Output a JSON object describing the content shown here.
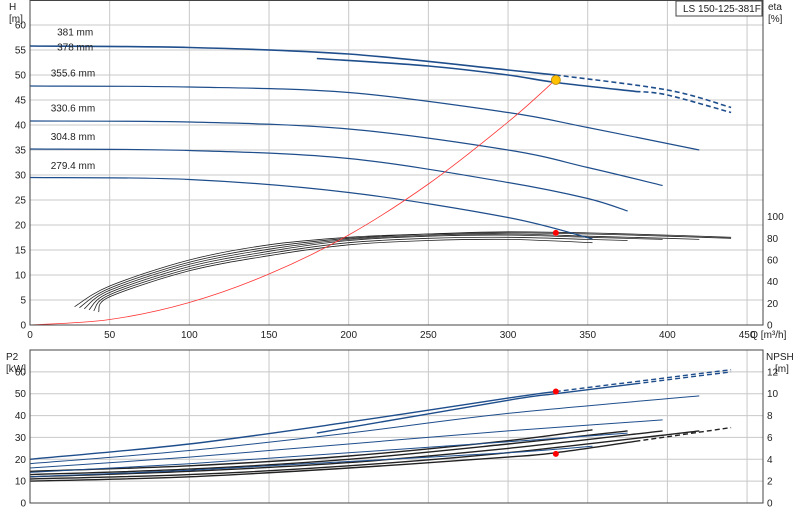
{
  "chart_data": [
    {
      "type": "line",
      "title": "LS 150-125-381F",
      "ylabel_left": "H",
      "ylabel_left_unit": "[m]",
      "ylabel_right": "eta",
      "ylabel_right_unit": "[%]",
      "xlabel": "Q [m³/h]",
      "x_ticks": [
        "0",
        "50",
        "100",
        "150",
        "200",
        "250",
        "300",
        "350",
        "400",
        "450"
      ],
      "xlim": [
        0,
        460
      ],
      "y_ticks": [
        "0",
        "5",
        "10",
        "15",
        "20",
        "25",
        "30",
        "35",
        "40",
        "45",
        "50",
        "55",
        "60"
      ],
      "ylim": [
        0,
        65
      ],
      "y_right_ticks": [
        "0",
        "20",
        "40",
        "60",
        "80",
        "100"
      ],
      "y_right_lim": [
        0,
        300
      ],
      "grid": true,
      "head_series": [
        {
          "name": "381 mm",
          "x": [
            0,
            100,
            200,
            300,
            330,
            400,
            440
          ],
          "y": [
            55.8,
            55.5,
            54.2,
            51.0,
            50.0,
            47.0,
            43.5
          ],
          "dash_from": 330
        },
        {
          "name": "378 mm",
          "x": [
            180,
            250,
            300,
            330,
            400,
            440
          ],
          "y": [
            53.3,
            51.8,
            50.0,
            48.5,
            46.0,
            42.5
          ],
          "dash_from": 380
        },
        {
          "name": "355.6 mm",
          "x": [
            0,
            100,
            200,
            300,
            350,
            420
          ],
          "y": [
            47.8,
            47.6,
            46.5,
            42.5,
            39.5,
            35.0
          ]
        },
        {
          "name": "330.6 mm",
          "x": [
            0,
            100,
            200,
            300,
            350,
            397
          ],
          "y": [
            40.8,
            40.6,
            39.2,
            35.0,
            31.5,
            27.9
          ]
        },
        {
          "name": "304.8 mm",
          "x": [
            0,
            100,
            200,
            300,
            350,
            375
          ],
          "y": [
            35.2,
            34.9,
            33.3,
            28.5,
            25.3,
            22.8
          ]
        },
        {
          "name": "279.4 mm",
          "x": [
            0,
            100,
            200,
            300,
            353
          ],
          "y": [
            29.5,
            29.1,
            26.5,
            21.5,
            17.2
          ]
        }
      ],
      "efficiency_series": [
        {
          "x": [
            28,
            50,
            100,
            150,
            200,
            250,
            300,
            350,
            400,
            440
          ],
          "y": [
            17,
            36,
            60,
            74,
            81,
            84,
            85,
            84,
            82,
            80
          ]
        },
        {
          "x": [
            31,
            50,
            100,
            150,
            200,
            250,
            300,
            350,
            400,
            440
          ],
          "y": [
            16,
            34,
            58,
            72,
            80,
            84,
            86,
            85,
            83,
            81
          ]
        },
        {
          "x": [
            34,
            50,
            100,
            150,
            200,
            250,
            300,
            350,
            400,
            420
          ],
          "y": [
            15,
            32,
            56,
            70,
            79,
            83,
            84,
            82,
            80,
            79
          ]
        },
        {
          "x": [
            37,
            50,
            100,
            150,
            200,
            250,
            300,
            350,
            397
          ],
          "y": [
            14,
            30,
            54,
            68,
            78,
            82,
            83,
            81,
            79
          ]
        },
        {
          "x": [
            40,
            50,
            100,
            150,
            200,
            250,
            300,
            350,
            375
          ],
          "y": [
            13,
            28,
            52,
            66,
            76,
            80,
            81,
            79,
            78
          ]
        },
        {
          "x": [
            43,
            50,
            100,
            150,
            200,
            250,
            300,
            353
          ],
          "y": [
            12,
            26,
            50,
            64,
            74,
            78,
            79,
            76
          ]
        }
      ],
      "system_curve": {
        "x": [
          0,
          50,
          100,
          150,
          200,
          250,
          300,
          330
        ],
        "y": [
          0,
          1.1,
          4.5,
          10.2,
          18.0,
          28.2,
          40.6,
          49.1
        ]
      },
      "duty_point": {
        "x": 330,
        "y": 49
      },
      "eta_point": {
        "x": 330,
        "y": 85
      }
    },
    {
      "type": "line",
      "ylabel_left": "P2",
      "ylabel_left_unit": "[kW]",
      "ylabel_right": "NPSH",
      "ylabel_right_unit": "[m]",
      "xlim": [
        0,
        460
      ],
      "y_ticks": [
        "0",
        "10",
        "20",
        "30",
        "40",
        "50",
        "60"
      ],
      "ylim": [
        0,
        70
      ],
      "y_right_ticks": [
        "0",
        "2",
        "4",
        "6",
        "8",
        "10",
        "12"
      ],
      "y_right_lim": [
        0,
        14
      ],
      "grid": true,
      "power_series": [
        {
          "x": [
            0,
            100,
            200,
            300,
            330,
            440
          ],
          "y": [
            20,
            27,
            37,
            48,
            51,
            61
          ],
          "dash_from": 330
        },
        {
          "x": [
            180,
            300,
            330,
            440
          ],
          "y": [
            32,
            47,
            50,
            60
          ],
          "dash_from": 380
        },
        {
          "x": [
            0,
            100,
            200,
            300,
            420
          ],
          "y": [
            18,
            24,
            32,
            41,
            49
          ]
        },
        {
          "x": [
            0,
            100,
            200,
            300,
            397
          ],
          "y": [
            16,
            21,
            27,
            33,
            38
          ]
        },
        {
          "x": [
            0,
            100,
            200,
            300,
            375
          ],
          "y": [
            14,
            18,
            23,
            28,
            32
          ]
        },
        {
          "x": [
            0,
            100,
            200,
            300,
            353
          ],
          "y": [
            12,
            15,
            19,
            23,
            26
          ]
        }
      ],
      "npsh_series": [
        {
          "x": [
            0,
            100,
            200,
            300,
            330,
            440
          ],
          "y": [
            2.0,
            2.4,
            3.2,
            4.2,
            4.6,
            6.9
          ],
          "dash_from": 380
        },
        {
          "x": [
            0,
            100,
            200,
            300,
            420
          ],
          "y": [
            2.2,
            2.6,
            3.4,
            4.6,
            6.6
          ]
        },
        {
          "x": [
            0,
            100,
            200,
            300,
            397
          ],
          "y": [
            2.4,
            2.9,
            3.7,
            5.0,
            6.6
          ]
        },
        {
          "x": [
            0,
            100,
            200,
            300,
            375
          ],
          "y": [
            2.6,
            3.1,
            4.0,
            5.4,
            6.6
          ]
        },
        {
          "x": [
            0,
            100,
            200,
            300,
            353
          ],
          "y": [
            2.9,
            3.4,
            4.3,
            5.7,
            6.7
          ]
        }
      ],
      "power_point": {
        "x": 330,
        "y": 51
      },
      "npsh_point": {
        "x": 330,
        "y": 4.5
      }
    }
  ],
  "colors": {
    "head": "#1f4e8c",
    "efficiency": "#222222",
    "system": "#ff3333",
    "duty": "#ffc000",
    "marker": "#ff0000",
    "grid": "#c8c8c8"
  }
}
